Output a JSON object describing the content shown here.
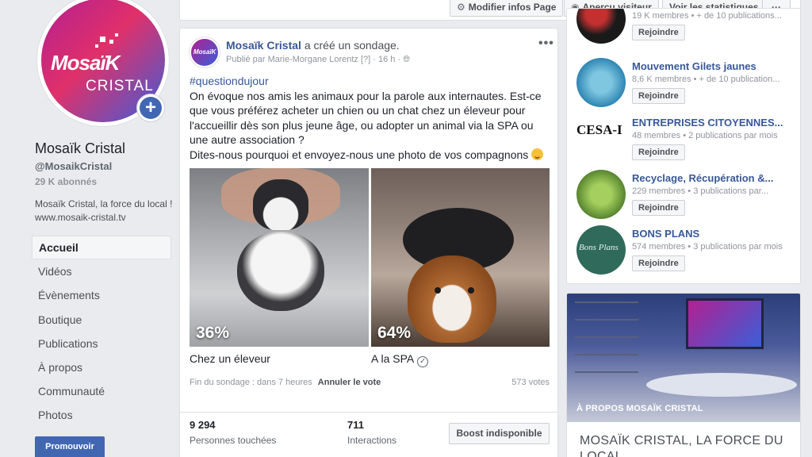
{
  "toolbar": {
    "edit_label": "Modifier infos Page",
    "preview_label": "Aperçu visiteur",
    "stats_label": "Voir les statistiques",
    "more_label": "···"
  },
  "page": {
    "name": "Mosaïk Cristal",
    "handle": "@MosaikCristal",
    "followers": "29 K abonnés",
    "description": "Mosaïk Cristal, la force du local ! www.mosaik-cristal.tv",
    "logo_line1": "MosaïK",
    "logo_line2": "CRISTAL",
    "plus": "+"
  },
  "nav": {
    "items": [
      {
        "label": "Accueil"
      },
      {
        "label": "Vidéos"
      },
      {
        "label": "Évènements"
      },
      {
        "label": "Boutique"
      },
      {
        "label": "Publications"
      },
      {
        "label": "À propos"
      },
      {
        "label": "Communauté"
      },
      {
        "label": "Photos"
      }
    ],
    "promote_label": "Promouvoir"
  },
  "post": {
    "author": "Mosaïk Cristal",
    "action": "a créé un sondage.",
    "published_by": "Publié par Marie-Morgane Lorentz",
    "help": "[?]",
    "time": "16 h",
    "menu": "•••",
    "hashtag": "#questiondujour",
    "body": "On évoque nos amis les animaux pour la parole aux internautes. Est-ce que vous préférez acheter un chien ou un chat chez un éleveur pour l'accueillir dès son plus jeune âge, ou adopter un animal via la SPA ou une autre association ?",
    "body2": "Dites-nous pourquoi et envoyez-nous une photo de vos compagnons",
    "avatar_text": "MosaïK"
  },
  "poll": {
    "options": [
      {
        "label": "Chez un éleveur",
        "percent_label": "36%",
        "percent": 36
      },
      {
        "label": "A la SPA",
        "percent_label": "64%",
        "percent": 64,
        "selected": true
      }
    ],
    "end_text": "Fin du sondage : dans 7 heures",
    "cancel_label": "Annuler le vote",
    "votes": "573 votes"
  },
  "stats": {
    "reach_value": "9 294",
    "reach_label": "Personnes touchées",
    "interactions_value": "711",
    "interactions_label": "Interactions",
    "boost_label": "Boost indisponible"
  },
  "groups": [
    {
      "name": "",
      "meta": "19 K membres • + de 10 publications...",
      "join": "Rejoindre",
      "thumb": "#3a1a1a"
    },
    {
      "name": "Mouvement Gilets jaunes",
      "meta": "8,6 K membres • + de 10 publication...",
      "join": "Rejoindre",
      "thumb": "#4aa3c8"
    },
    {
      "name": "ENTREPRISES CITOYENNES...",
      "meta": "48 membres • 2 publications par mois",
      "join": "Rejoindre",
      "thumb_text": "CESA-I"
    },
    {
      "name": "Recyclage, Récupération &...",
      "meta": "229 membres • 3 publications par...",
      "join": "Rejoindre",
      "thumb": "#6a9a3a"
    },
    {
      "name": "BONS PLANS",
      "meta": "574 membres • 3 publications par mois",
      "join": "Rejoindre",
      "thumb": "#2f6a5a",
      "thumb_text": "Bons Plans"
    }
  ],
  "about": {
    "caption": "À PROPOS MOSAÏK CRISTAL",
    "title": "MOSAÏK CRISTAL, LA FORCE DU LOCAL"
  },
  "colors": {
    "accent": "#4267b2",
    "link": "#385898",
    "background": "#e9ebee"
  }
}
